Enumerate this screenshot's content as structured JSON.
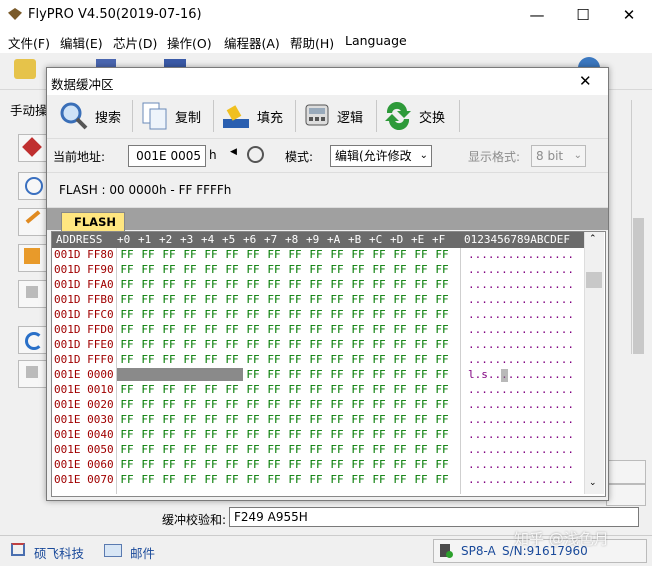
{
  "window": {
    "title": "FlyPRO V4.50(2019-07-16)",
    "controls": {
      "minimize": "—",
      "maximize": "☐",
      "close": "✕"
    }
  },
  "menu": [
    "文件(F)",
    "编辑(E)",
    "芯片(D)",
    "操作(O)",
    "编程器(A)",
    "帮助(H)",
    "Language"
  ],
  "left_panel": {
    "label": "手动操"
  },
  "dialog": {
    "title": "数据缓冲区",
    "close": "✕",
    "toolbar": [
      {
        "label": "搜索",
        "icon": "magnifier-icon"
      },
      {
        "label": "复制",
        "icon": "copy-icon"
      },
      {
        "label": "填充",
        "icon": "fill-icon"
      },
      {
        "label": "逻辑",
        "icon": "logic-icon"
      },
      {
        "label": "交换",
        "icon": "swap-icon"
      }
    ],
    "address_label": "当前地址:",
    "address_value": "001E 0005",
    "address_suffix": "h",
    "mode_label": "模式:",
    "mode_value": "编辑(允许修改",
    "display_label": "显示格式:",
    "display_value": "8 bit",
    "range_text": "FLASH : 00 0000h - FF FFFFh",
    "tab": "FLASH",
    "hex": {
      "header_address": "ADDRESS",
      "columns": [
        "+0",
        "+1",
        "+2",
        "+3",
        "+4",
        "+5",
        "+6",
        "+7",
        "+8",
        "+9",
        "+A",
        "+B",
        "+C",
        "+D",
        "+E",
        "+F"
      ],
      "ascii_header": "0123456789ABCDEF",
      "rows": [
        {
          "address": "001D FF80",
          "ascii": "................"
        },
        {
          "address": "001D FF90",
          "ascii": "................"
        },
        {
          "address": "001D FFA0",
          "ascii": "................"
        },
        {
          "address": "001D FFB0",
          "ascii": "................"
        },
        {
          "address": "001D FFC0",
          "ascii": "................"
        },
        {
          "address": "001D FFD0",
          "ascii": "................"
        },
        {
          "address": "001D FFE0",
          "ascii": "................"
        },
        {
          "address": "001D FFF0",
          "ascii": "................"
        },
        {
          "address": "001E 0000",
          "ascii": "l.s............."
        },
        {
          "address": "001E 0010",
          "ascii": "................"
        },
        {
          "address": "001E 0020",
          "ascii": "................"
        },
        {
          "address": "001E 0030",
          "ascii": "................"
        },
        {
          "address": "001E 0040",
          "ascii": "................"
        },
        {
          "address": "001E 0050",
          "ascii": "................"
        },
        {
          "address": "001E 0060",
          "ascii": "................"
        },
        {
          "address": "001E 0070",
          "ascii": "................"
        }
      ],
      "byte_value": "FF"
    }
  },
  "checksum": {
    "label": "缓冲校验和:",
    "value": "F249 A955H"
  },
  "statusbar": {
    "company": "硕飞科技",
    "email": "邮件",
    "device": "SP8-A",
    "serial": "S/N:91617960",
    "watermark": "知乎 @浅色月"
  },
  "colors": {
    "address": "#a00000",
    "bytes": "#007a00",
    "ascii": "#800080",
    "tab": "#ffe680"
  }
}
